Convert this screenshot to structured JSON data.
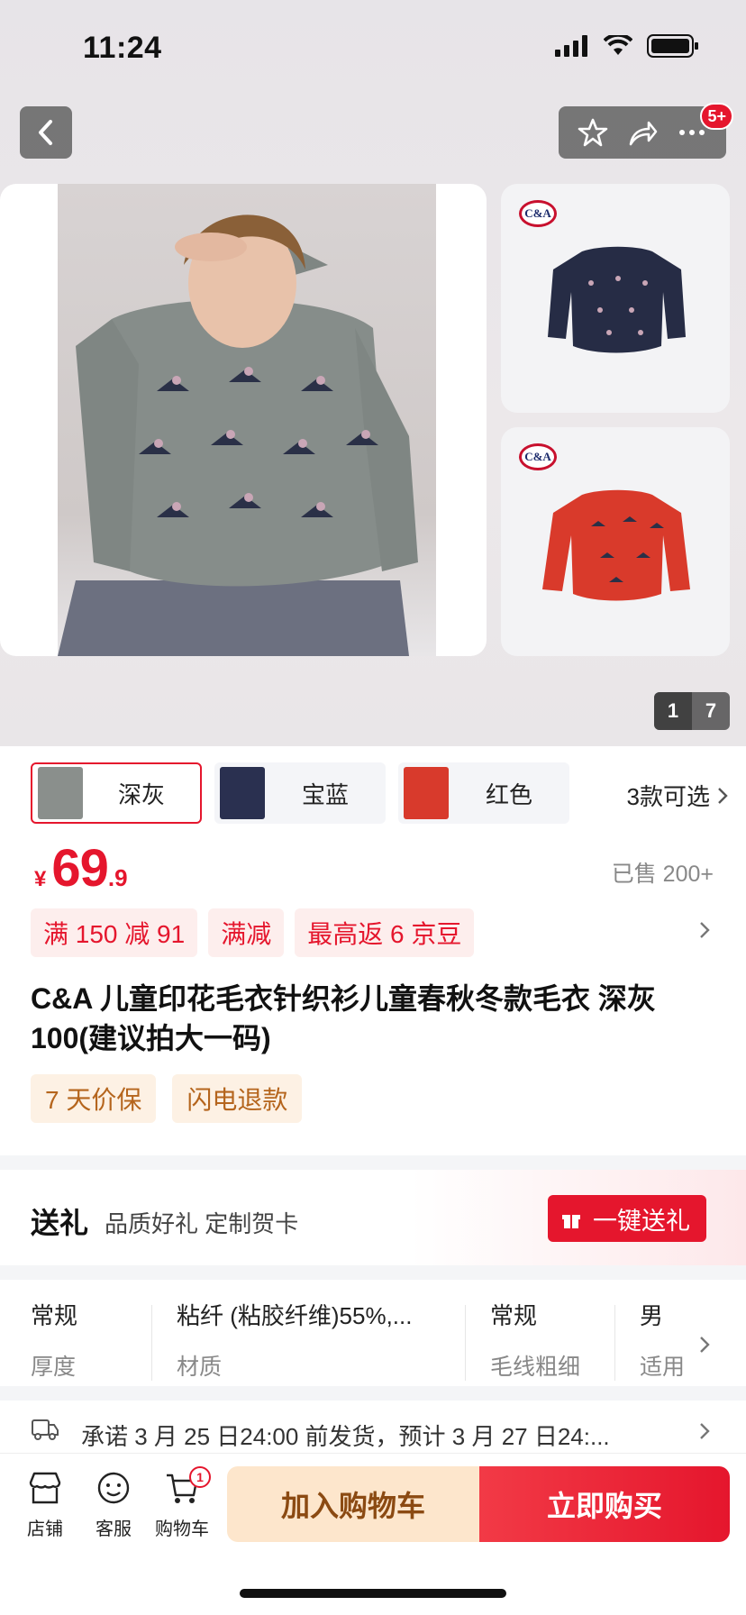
{
  "status": {
    "time": "11:24"
  },
  "header": {
    "badge": "5+"
  },
  "gallery": {
    "brand": "C&A",
    "page_current": "1",
    "page_total": "7"
  },
  "variants": {
    "items": [
      {
        "label": "深灰",
        "thumb_color": "#8a8f8c",
        "active": true
      },
      {
        "label": "宝蓝",
        "thumb_color": "#2a3050",
        "active": false
      },
      {
        "label": "红色",
        "thumb_color": "#d83a2c",
        "active": false
      }
    ],
    "more": "3款可选"
  },
  "price": {
    "currency": "¥",
    "integer": "69",
    "decimal": ".9",
    "sold": "已售 200+"
  },
  "promos": [
    "满 150 减 91",
    "满减",
    "最高返 6 京豆"
  ],
  "product": {
    "title": "C&A 儿童印花毛衣针织衫儿童春秋冬款毛衣 深灰 100(建议拍大一码)"
  },
  "services": [
    "7 天价保",
    "闪电退款"
  ],
  "gift": {
    "title": "送礼",
    "subtitle": "品质好礼 定制贺卡",
    "button": "一键送礼"
  },
  "specs": [
    {
      "value": "常规",
      "key": "厚度"
    },
    {
      "value": "粘纤 (粘胶纤维)55%,...",
      "key": "材质"
    },
    {
      "value": "常规",
      "key": "毛线粗细"
    },
    {
      "value": "男",
      "key": "适用"
    }
  ],
  "delivery": {
    "text": "承诺 3 月 25 日24:00 前发货，预计 3 月 27 日24:..."
  },
  "bottom": {
    "tabs": [
      "店铺",
      "客服",
      "购物车"
    ],
    "cart_count": "1",
    "add_to_cart": "加入购物车",
    "buy_now": "立即购买"
  },
  "colors": {
    "accent": "#e5162d",
    "cart_bg": "#fde6cc",
    "service_bg": "#fdf1e4"
  }
}
